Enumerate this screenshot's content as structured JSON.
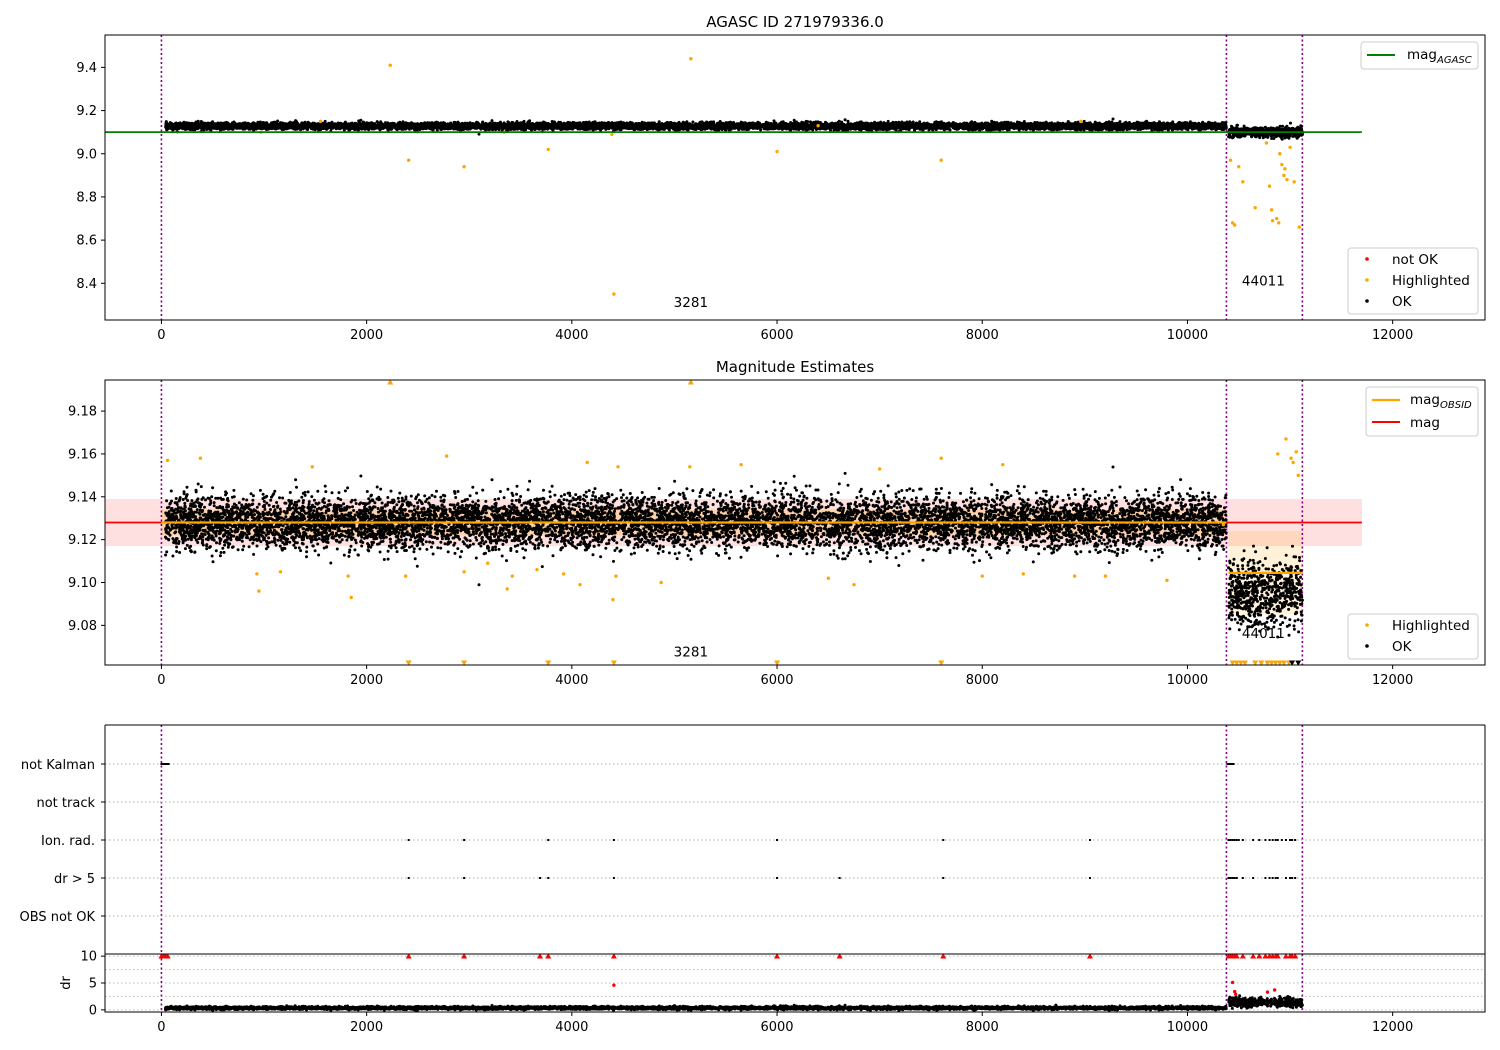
{
  "figure": {
    "title": "AGASC ID 271979336.0"
  },
  "chart_data": [
    {
      "type": "scatter",
      "name": "mag-agasc-panel",
      "title": "AGASC ID 271979336.0",
      "xlim": [
        -550,
        12900
      ],
      "ylim": [
        8.23,
        9.55
      ],
      "xticks": [
        0,
        2000,
        4000,
        6000,
        8000,
        10000,
        12000
      ],
      "yticks": [
        8.4,
        8.6,
        8.8,
        9.0,
        9.2,
        9.4
      ],
      "obsid_boundaries": [
        0,
        10380,
        11120
      ],
      "obsid_labels": [
        {
          "text": "3281",
          "x": 5160,
          "y": 8.29
        },
        {
          "text": "44011",
          "x": 10740,
          "y": 8.39
        }
      ],
      "series": [
        {
          "name": "mag_AGASC",
          "kind": "hline",
          "y": 9.1,
          "x_range": [
            -550,
            11700
          ],
          "color": "#008000"
        },
        {
          "name": "OK",
          "kind": "band-scatter",
          "color": "#000000",
          "segments": [
            {
              "x_range": [
                40,
                10380
              ],
              "center": 9.128,
              "spread": 0.014
            },
            {
              "x_range": [
                10400,
                11120
              ],
              "center": 9.1,
              "spread": 0.02
            }
          ]
        },
        {
          "name": "Highlighted",
          "kind": "points",
          "color": "#ffa500",
          "points": [
            [
              2230,
              9.41
            ],
            [
              5160,
              9.44
            ],
            [
              2410,
              8.97
            ],
            [
              2950,
              8.94
            ],
            [
              3770,
              9.02
            ],
            [
              4410,
              8.35
            ],
            [
              4390,
              9.09
            ],
            [
              6000,
              9.01
            ],
            [
              7600,
              8.97
            ],
            [
              10440,
              8.68
            ],
            [
              10460,
              8.67
            ],
            [
              10420,
              8.97
            ],
            [
              10500,
              8.94
            ],
            [
              10540,
              8.87
            ],
            [
              10660,
              8.75
            ],
            [
              10770,
              9.05
            ],
            [
              10800,
              8.85
            ],
            [
              10820,
              8.74
            ],
            [
              10830,
              8.69
            ],
            [
              10870,
              8.7
            ],
            [
              10890,
              8.68
            ],
            [
              10900,
              9.0
            ],
            [
              10920,
              8.95
            ],
            [
              10940,
              8.9
            ],
            [
              10950,
              8.93
            ],
            [
              10970,
              8.88
            ],
            [
              11040,
              8.87
            ],
            [
              11090,
              8.66
            ],
            [
              11000,
              9.03
            ],
            [
              1550,
              9.15
            ],
            [
              970,
              9.1
            ],
            [
              3340,
              9.1
            ],
            [
              6400,
              9.13
            ],
            [
              8960,
              9.15
            ]
          ]
        },
        {
          "name": "not OK",
          "kind": "points",
          "color": "#ff0000",
          "points": []
        }
      ],
      "legend_lines": [
        "mag_AGASC"
      ],
      "legend_points": [
        "not OK",
        "Highlighted",
        "OK"
      ]
    },
    {
      "type": "scatter",
      "name": "magnitude-estimates-panel",
      "title": "Magnitude Estimates",
      "xlim": [
        -550,
        12900
      ],
      "ylim": [
        9.0615,
        9.1945
      ],
      "xticks": [
        0,
        2000,
        4000,
        6000,
        8000,
        10000,
        12000
      ],
      "yticks": [
        9.08,
        9.1,
        9.12,
        9.14,
        9.16,
        9.18
      ],
      "obsid_boundaries": [
        0,
        10380,
        11120
      ],
      "obsid_labels": [
        {
          "text": "3281",
          "x": 5160,
          "y": 9.0655
        },
        {
          "text": "44011",
          "x": 10740,
          "y": 9.074
        }
      ],
      "bands": [
        {
          "x_range": [
            -550,
            11700
          ],
          "y_range": [
            9.117,
            9.139
          ],
          "color": "#ff0000",
          "opacity": 0.12
        },
        {
          "x_range": [
            0,
            10380
          ],
          "y_range": [
            9.122,
            9.134
          ],
          "color": "#ffa500",
          "opacity": 0.25
        },
        {
          "x_range": [
            10400,
            11120
          ],
          "y_range": [
            9.085,
            9.124
          ],
          "color": "#ffa500",
          "opacity": 0.15
        }
      ],
      "series": [
        {
          "name": "mag",
          "kind": "hline",
          "y": 9.128,
          "x_range": [
            -550,
            11700
          ],
          "color": "#ff0000"
        },
        {
          "name": "mag_OBSID",
          "kind": "segments",
          "color": "#ffa500",
          "segments": [
            {
              "x_range": [
                0,
                10380
              ],
              "y": 9.128
            },
            {
              "x_range": [
                10400,
                11120
              ],
              "y": 9.1045
            }
          ]
        },
        {
          "name": "OK",
          "kind": "band-scatter",
          "color": "#000000",
          "segments": [
            {
              "x_range": [
                40,
                10380
              ],
              "center": 9.128,
              "spread": 0.011
            },
            {
              "x_range": [
                10400,
                11120
              ],
              "center": 9.095,
              "spread": 0.014
            }
          ]
        },
        {
          "name": "Highlighted",
          "kind": "points",
          "color": "#ffa500",
          "points": [
            [
              60,
              9.157
            ],
            [
              380,
              9.158
            ],
            [
              930,
              9.104
            ],
            [
              950,
              9.096
            ],
            [
              1160,
              9.105
            ],
            [
              1470,
              9.154
            ],
            [
              1850,
              9.093
            ],
            [
              1820,
              9.103
            ],
            [
              2380,
              9.103
            ],
            [
              2780,
              9.159
            ],
            [
              2950,
              9.105
            ],
            [
              3180,
              9.109
            ],
            [
              3370,
              9.097
            ],
            [
              3420,
              9.103
            ],
            [
              3660,
              9.106
            ],
            [
              3920,
              9.104
            ],
            [
              4080,
              9.099
            ],
            [
              4400,
              9.092
            ],
            [
              4430,
              9.103
            ],
            [
              4150,
              9.156
            ],
            [
              4450,
              9.154
            ],
            [
              4870,
              9.1
            ],
            [
              5150,
              9.154
            ],
            [
              5650,
              9.155
            ],
            [
              6500,
              9.102
            ],
            [
              6750,
              9.099
            ],
            [
              7000,
              9.153
            ],
            [
              7600,
              9.158
            ],
            [
              8000,
              9.103
            ],
            [
              8200,
              9.155
            ],
            [
              8400,
              9.104
            ],
            [
              8900,
              9.103
            ],
            [
              9200,
              9.103
            ],
            [
              9800,
              9.101
            ],
            [
              10350,
              9.127
            ],
            [
              10880,
              9.16
            ],
            [
              10960,
              9.167
            ],
            [
              11010,
              9.158
            ],
            [
              11030,
              9.156
            ],
            [
              11060,
              9.161
            ],
            [
              11080,
              9.15
            ]
          ]
        },
        {
          "name": "Highlighted (off-scale high)",
          "kind": "markers-up",
          "color": "#ffa500",
          "points": [
            [
              2230,
              9.1935
            ],
            [
              5160,
              9.1935
            ]
          ]
        },
        {
          "name": "Highlighted (off-scale low)",
          "kind": "markers-down",
          "color": "#ffa500",
          "points": [
            [
              2410,
              9.0625
            ],
            [
              2950,
              9.0625
            ],
            [
              3770,
              9.0625
            ],
            [
              4410,
              9.0625
            ],
            [
              6000,
              9.0625
            ],
            [
              7600,
              9.0625
            ],
            [
              10440,
              9.0625
            ],
            [
              10480,
              9.0625
            ],
            [
              10520,
              9.0625
            ],
            [
              10560,
              9.0625
            ],
            [
              10660,
              9.0625
            ],
            [
              10720,
              9.0625
            ],
            [
              10780,
              9.0625
            ],
            [
              10820,
              9.0625
            ],
            [
              10860,
              9.0625
            ],
            [
              10900,
              9.0625
            ],
            [
              10940,
              9.0625
            ],
            [
              10990,
              9.0625
            ]
          ]
        },
        {
          "name": "OK (off-scale low)",
          "kind": "markers-down",
          "color": "#000000",
          "points": [
            [
              11020,
              9.0625
            ],
            [
              11080,
              9.0625
            ]
          ]
        }
      ],
      "legend_lines": [
        "mag_OBSID",
        "mag"
      ],
      "legend_points": [
        "Highlighted",
        "OK"
      ]
    },
    {
      "type": "scatter",
      "name": "flags-panel",
      "xlim": [
        -550,
        12900
      ],
      "ylim": [
        0,
        6
      ],
      "rows": [
        "not Kalman",
        "not track",
        "Ion. rad.",
        "dr > 5",
        "OBS not OK"
      ],
      "obsid_boundaries": [
        0,
        10380,
        11120
      ],
      "series": [
        {
          "name": "not Kalman",
          "row": 0,
          "x": [
            0,
            10,
            20,
            30,
            40,
            50,
            60,
            70,
            10390,
            10400,
            10410,
            10420,
            10430,
            10440,
            10450
          ]
        },
        {
          "name": "not track",
          "row": 1,
          "x": []
        },
        {
          "name": "Ion. rad.",
          "row": 2,
          "x": [
            2410,
            2950,
            3770,
            4410,
            6000,
            7620,
            9050,
            10400,
            10420,
            10440,
            10460,
            10480,
            10500,
            10540,
            10640,
            10700,
            10760,
            10800,
            10830,
            10860,
            10880,
            10920,
            10960,
            11000,
            11020,
            11050
          ]
        },
        {
          "name": "dr > 5",
          "row": 3,
          "x": [
            2410,
            2950,
            3690,
            3770,
            4410,
            6000,
            6610,
            7620,
            9050,
            10400,
            10420,
            10440,
            10460,
            10480,
            10540,
            10640,
            10760,
            10800,
            10830,
            10860,
            10880,
            10960,
            11000,
            11020,
            11050
          ]
        },
        {
          "name": "OBS not OK",
          "row": 4,
          "x": []
        }
      ]
    },
    {
      "type": "scatter",
      "name": "dr-panel",
      "ylabel": "dr",
      "xlim": [
        -550,
        12900
      ],
      "ylim": [
        -0.4,
        10.4
      ],
      "xticks": [
        0,
        2000,
        4000,
        6000,
        8000,
        10000,
        12000
      ],
      "yticks": [
        0,
        5,
        10
      ],
      "obsid_boundaries": [
        0,
        10380,
        11120
      ],
      "series": [
        {
          "name": "dr",
          "kind": "band-scatter",
          "color": "#000000",
          "segments": [
            {
              "x_range": [
                40,
                10380
              ],
              "center": 0.35,
              "spread": 0.25
            },
            {
              "x_range": [
                10400,
                11120
              ],
              "center": 1.4,
              "spread": 0.8
            }
          ]
        },
        {
          "name": "dr (clipped)",
          "kind": "markers-up",
          "color": "#ff0000",
          "points": [
            [
              0,
              10
            ],
            [
              20,
              10
            ],
            [
              40,
              10
            ],
            [
              60,
              10
            ],
            [
              2410,
              10
            ],
            [
              2950,
              10
            ],
            [
              3690,
              10
            ],
            [
              3770,
              10
            ],
            [
              4410,
              10
            ],
            [
              6000,
              10
            ],
            [
              6610,
              10
            ],
            [
              7620,
              10
            ],
            [
              9050,
              10
            ],
            [
              10400,
              10
            ],
            [
              10420,
              10
            ],
            [
              10440,
              10
            ],
            [
              10460,
              10
            ],
            [
              10480,
              10
            ],
            [
              10540,
              10
            ],
            [
              10640,
              10
            ],
            [
              10700,
              10
            ],
            [
              10760,
              10
            ],
            [
              10800,
              10
            ],
            [
              10830,
              10
            ],
            [
              10860,
              10
            ],
            [
              10880,
              10
            ],
            [
              10960,
              10
            ],
            [
              11000,
              10
            ],
            [
              11020,
              10
            ],
            [
              11050,
              10
            ]
          ]
        },
        {
          "name": "dr (not OK)",
          "kind": "points",
          "color": "#ff0000",
          "points": [
            [
              4410,
              4.6
            ],
            [
              10440,
              5.1
            ],
            [
              10460,
              3.4
            ],
            [
              10470,
              2.9
            ],
            [
              10780,
              3.3
            ],
            [
              10850,
              3.7
            ]
          ]
        }
      ]
    }
  ]
}
